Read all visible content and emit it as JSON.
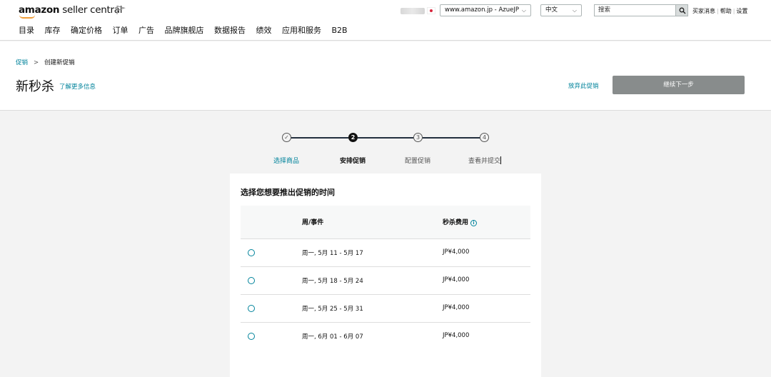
{
  "header": {
    "logo_bold": "amazon",
    "logo_rest": " seller central",
    "marketplace_value": "www.amazon.jp - AzueJP",
    "language_value": "中文",
    "search_placeholder": "搜索",
    "links": [
      "买家消息",
      "帮助",
      "设置"
    ],
    "nav": [
      "目录",
      "库存",
      "确定价格",
      "订单",
      "广告",
      "品牌旗舰店",
      "数据报告",
      "绩效",
      "应用和服务",
      "B2B"
    ]
  },
  "page": {
    "breadcrumb_link": "促销",
    "breadcrumb_arrow": ">",
    "breadcrumb_current": "创建新促销",
    "title": "新秒杀",
    "learn_more": "了解更多信息",
    "abandon": "放弃此促销",
    "continue_label": "继续下一步"
  },
  "steps": [
    {
      "number": "✓",
      "label": "选择商品",
      "state": "done"
    },
    {
      "number": "2",
      "label": "安排促销",
      "state": "active"
    },
    {
      "number": "3",
      "label": "配置促销",
      "state": "pending"
    },
    {
      "number": "4",
      "label": "查看并提交",
      "state": "pending"
    }
  ],
  "schedule": {
    "title": "选择您想要推出促销的时间",
    "col_week": "周/事件",
    "col_fee": "秒杀费用",
    "rows": [
      {
        "week": "周一, 5月 11 - 5月 17",
        "fee": "JP¥4,000"
      },
      {
        "week": "周一, 5月 18 - 5月 24",
        "fee": "JP¥4,000"
      },
      {
        "week": "周一, 5月 25 - 5月 31",
        "fee": "JP¥4,000"
      },
      {
        "week": "周一, 6月 01 - 6月 07",
        "fee": "JP¥4,000"
      }
    ]
  },
  "colors": {
    "accent": "#00839b",
    "logo_smile": "#f19e39",
    "button_disabled": "#888c8c",
    "stepper_line": "#232f3e"
  }
}
